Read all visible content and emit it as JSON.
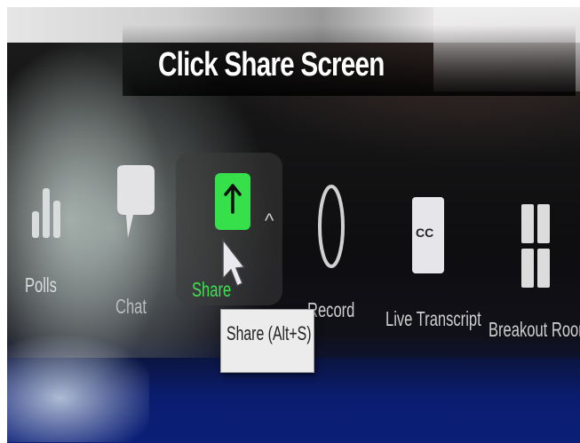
{
  "caption": "Click Share Screen",
  "toolbar": {
    "polls_label": "Polls",
    "chat_label": "Chat",
    "share_label": "Share",
    "share_menu_caret": "^",
    "record_label": "Record",
    "live_transcript_label": "Live Transcript",
    "cc_badge": "CC",
    "breakout_label": "Breakout Room"
  },
  "tooltip": {
    "text": "Share (Alt+S)"
  },
  "colors": {
    "share_green": "#35e04a",
    "toolbar_bg": "#121212",
    "label_gray": "#cfcfcf"
  }
}
